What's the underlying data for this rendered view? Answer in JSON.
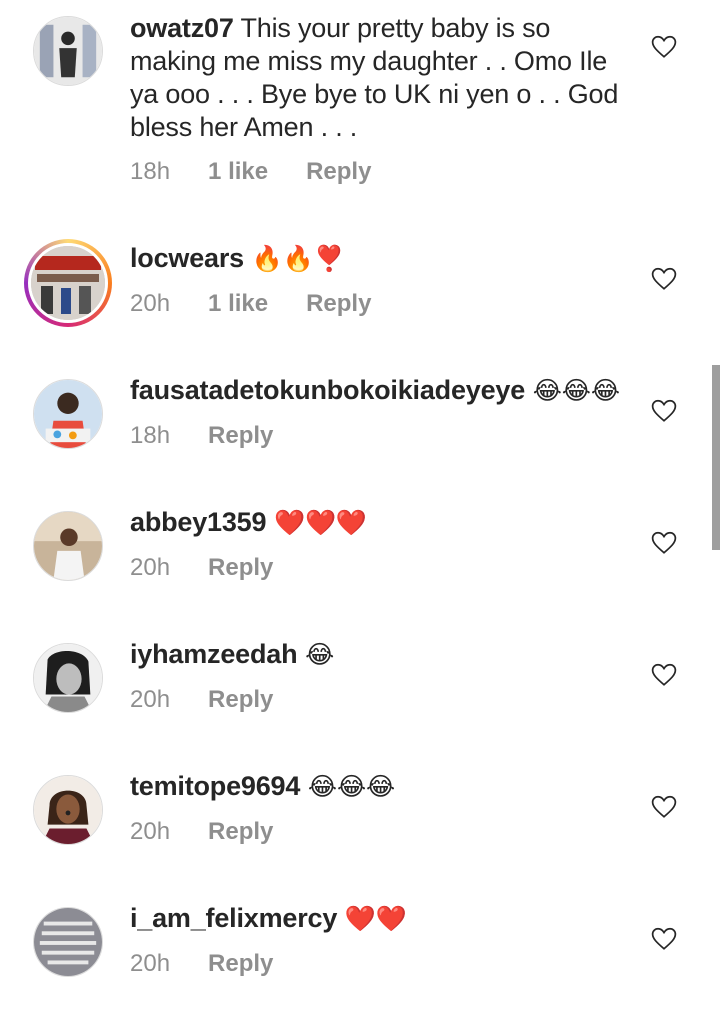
{
  "comments": [
    {
      "username": "owatz07",
      "text": " This your pretty baby is so making me miss my daughter . . Omo Ile ya ooo . . . Bye bye to UK ni yen o . . God bless her Amen . . .",
      "time": "18h",
      "likes": "1 like",
      "reply": "Reply",
      "avatar": "avatar-photo"
    },
    {
      "username": "locwears",
      "text": " 🔥🔥❣️",
      "time": "20h",
      "likes": "1 like",
      "reply": "Reply",
      "avatar": "avatar-story-ring"
    },
    {
      "username": "fausatadetokunbokoikiadeyeye",
      "text": " 😂😂😂",
      "time": "18h",
      "likes": "",
      "reply": "Reply",
      "avatar": "avatar-photo"
    },
    {
      "username": "abbey1359",
      "text": " ❤️❤️❤️",
      "time": "20h",
      "likes": "",
      "reply": "Reply",
      "avatar": "avatar-photo"
    },
    {
      "username": "iyhamzeedah",
      "text": " 😂",
      "time": "20h",
      "likes": "",
      "reply": "Reply",
      "avatar": "avatar-photo"
    },
    {
      "username": "temitope9694",
      "text": " 😂😂😂",
      "time": "20h",
      "likes": "",
      "reply": "Reply",
      "avatar": "avatar-photo"
    },
    {
      "username": "i_am_felixmercy",
      "text": " ❤️❤️",
      "time": "20h",
      "likes": "",
      "reply": "Reply",
      "avatar": "avatar-photo"
    }
  ],
  "icons": {
    "like": "heart-outline-icon"
  },
  "colors": {
    "meta": "#8e8e8e",
    "text": "#262626",
    "scrollbar": "#9e9e9e"
  }
}
